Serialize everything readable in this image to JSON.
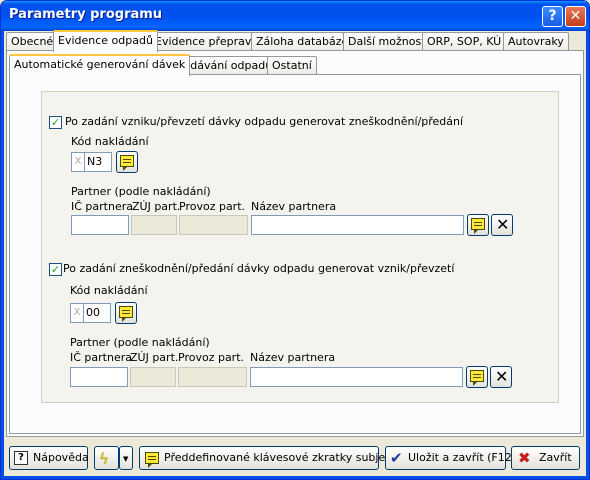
{
  "window": {
    "title": "Parametry programu"
  },
  "tabs_top": [
    "Obecné",
    "Evidence odpadů",
    "Evidence přepravy",
    "Záloha databáze",
    "Další možnosti",
    "ORP, SOP, KÚ",
    "Autovraky"
  ],
  "tabs_sub": [
    "Automatické generování dávek",
    "Zadávání odpadů",
    "Ostatní"
  ],
  "section1": {
    "checkbox_label": "Po zadání vzniku/převzetí dávky odpadu generovat zneškodnění/předání",
    "checked": true,
    "kod_label": "Kód nakládání",
    "kod_prefix": "X",
    "kod_value": "N3",
    "partner_label": "Partner (podle nakládání)",
    "col_ic": "IČ partnera",
    "col_zuj": "ZÚJ part.",
    "col_provoz": "Provoz part.",
    "col_nazev": "Název partnera",
    "ic_value": "",
    "nazev_value": ""
  },
  "section2": {
    "checkbox_label": "Po zadání zneškodnění/předání dávky odpadu generovat vznik/převzetí",
    "checked": true,
    "kod_label": "Kód nakládání",
    "kod_prefix": "X",
    "kod_value": "00",
    "partner_label": "Partner (podle nakládání)",
    "col_ic": "IČ partnera",
    "col_zuj": "ZÚJ part.",
    "col_provoz": "Provoz part.",
    "col_nazev": "Název partnera",
    "ic_value": "",
    "nazev_value": ""
  },
  "buttons": {
    "help": "Nápověda",
    "shortcuts": "Předdefinované klávesové zkratky subjektů",
    "save": "Uložit a zavřít (F12)",
    "close": "Zavřít"
  },
  "colors": {
    "titlebar": "#0053ee",
    "tab_highlight": "#ffc83c",
    "check": "#21a121"
  }
}
